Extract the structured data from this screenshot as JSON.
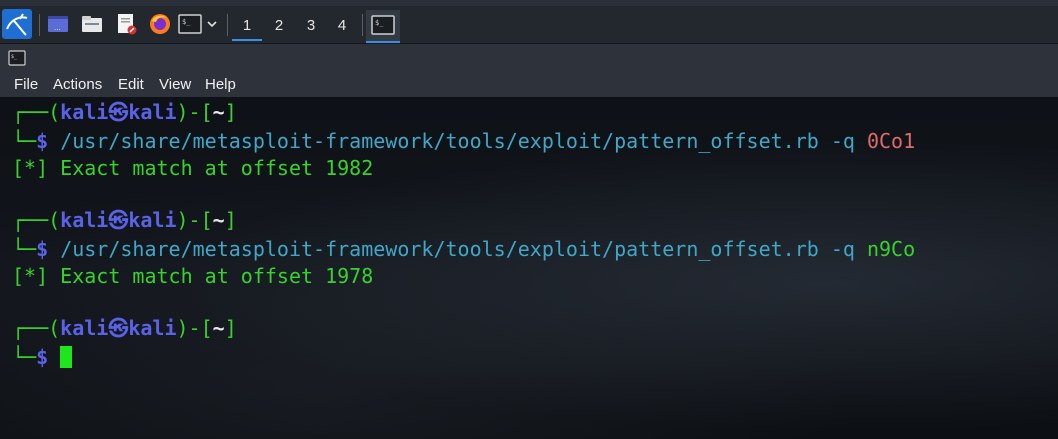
{
  "panel": {
    "workspaces": [
      "1",
      "2",
      "3",
      "4"
    ],
    "active_workspace": "1",
    "colors": {
      "accent": "#3a8ee6"
    }
  },
  "window": {
    "menu": [
      "File",
      "Actions",
      "Edit",
      "View",
      "Help"
    ]
  },
  "terminal": {
    "prompt": {
      "user": "kali",
      "host": "kali",
      "dir": "~",
      "symbol": "$"
    },
    "blocks": [
      {
        "command": "/usr/share/metasploit-framework/tools/exploit/pattern_offset.rb",
        "flag": "-q",
        "arg": "0Co1",
        "output_marker": "[*]",
        "output": "Exact match at offset 1982"
      },
      {
        "command": "/usr/share/metasploit-framework/tools/exploit/pattern_offset.rb",
        "flag": "-q",
        "arg": "n9Co",
        "output_marker": "[*]",
        "output": "Exact match at offset 1978"
      }
    ],
    "colors": {
      "prompt_frame": "#37d32c",
      "user_host": "#5a63e8",
      "path": "#3fa7c7",
      "arg_first": "#e06a6a",
      "cursor": "#1de61a"
    }
  }
}
